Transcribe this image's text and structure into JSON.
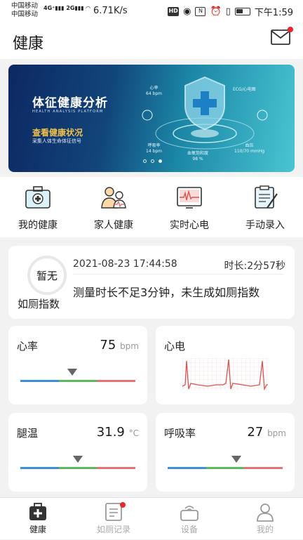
{
  "status_bar": {
    "carrier1": "中国移动",
    "carrier2": "中国移动",
    "net_speed": "6.71K/s",
    "time": "下午1:59"
  },
  "header": {
    "title": "健康"
  },
  "banner": {
    "title": "体征健康分析",
    "subtitle": "HEALTH ANALYSIS PLATFORM",
    "link": "查看健康状况",
    "desc": "采集人体生命体征信号",
    "labels": {
      "hr": "心率",
      "hr_val": "64 bpm",
      "ecg": "ECG/心电图",
      "resp": "呼吸率",
      "resp_val": "14 bpm",
      "bp": "血压",
      "bp_val": "110/70 mmHg",
      "spo2": "血氧饱和度",
      "spo2_val": "98 %"
    },
    "slide_index": 3,
    "slide_count": 3
  },
  "quick": [
    {
      "label": "我的健康",
      "icon": "medical-kit-icon"
    },
    {
      "label": "家人健康",
      "icon": "family-icon"
    },
    {
      "label": "实时心电",
      "icon": "ecg-monitor-icon"
    },
    {
      "label": "手动录入",
      "icon": "clipboard-pen-icon"
    }
  ],
  "index_card": {
    "ring_text": "暂无",
    "ring_label": "如厕指数",
    "datetime": "2021-08-23 17:44:58",
    "duration": "时长:2分57秒",
    "message": "测量时长不足3分钟，未生成如厕指数"
  },
  "metrics": {
    "heart_rate": {
      "label": "心率",
      "value": "75",
      "unit": "bpm",
      "level": 0.45
    },
    "ecg": {
      "label": "心电"
    },
    "leg_temp": {
      "label": "腿温",
      "value": "31.9",
      "unit": "°C",
      "level": 0.5
    },
    "resp_rate": {
      "label": "呼吸率",
      "value": "27",
      "unit": "bpm",
      "level": 0.6
    }
  },
  "colors": {
    "low": "#3b8fd8",
    "normal": "#5cb85c",
    "high": "#e57373",
    "badge": "#e8262b"
  },
  "tabs": [
    {
      "label": "健康",
      "active": true
    },
    {
      "label": "如厕记录",
      "active": false
    },
    {
      "label": "设备",
      "active": false
    },
    {
      "label": "我的",
      "active": false
    }
  ]
}
